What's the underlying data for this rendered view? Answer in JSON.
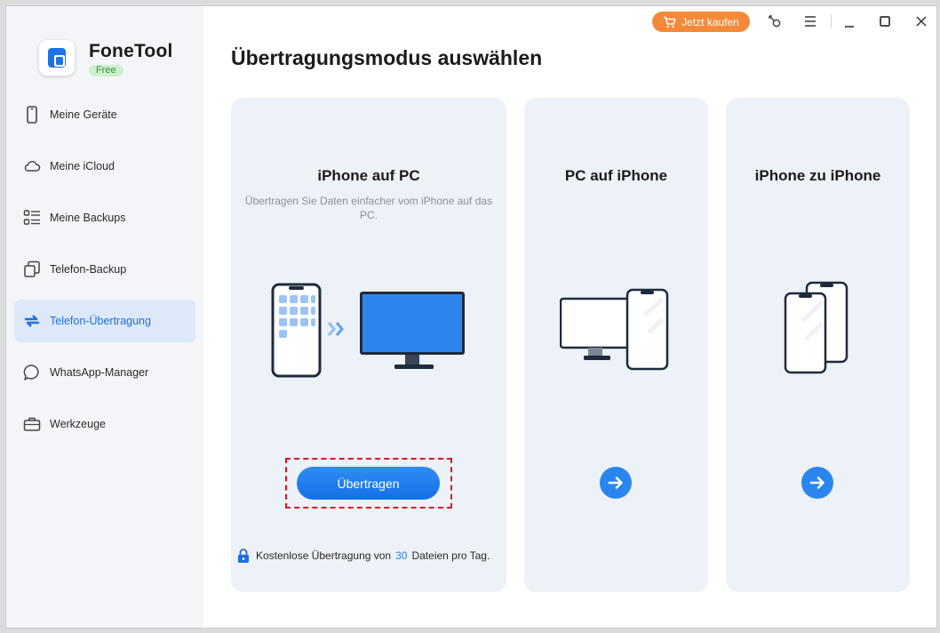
{
  "app": {
    "name": "FoneTool",
    "badge": "Free"
  },
  "sidebar": {
    "items": [
      {
        "label": "Meine Geräte",
        "icon": "phone-icon",
        "active": false
      },
      {
        "label": "Meine iCloud",
        "icon": "cloud-icon",
        "active": false
      },
      {
        "label": "Meine Backups",
        "icon": "list-icon",
        "active": false
      },
      {
        "label": "Telefon-Backup",
        "icon": "copy-icon",
        "active": false
      },
      {
        "label": "Telefon-Übertragung",
        "icon": "transfer-arrows-icon",
        "active": true
      },
      {
        "label": "WhatsApp-Manager",
        "icon": "chat-bubble-icon",
        "active": false
      },
      {
        "label": "Werkzeuge",
        "icon": "toolbox-icon",
        "active": false
      }
    ]
  },
  "titlebar": {
    "buy_label": "Jetzt kaufen"
  },
  "main": {
    "title": "Übertragungsmodus auswählen",
    "cards": [
      {
        "title": "iPhone auf PC",
        "description": "Übertragen Sie Daten einfacher vom iPhone auf das PC.",
        "button_label": "Übertragen",
        "footnote_before": "Kostenlose Übertragung von",
        "footnote_count": "30",
        "footnote_after": "Dateien pro Tag."
      },
      {
        "title": "PC auf iPhone"
      },
      {
        "title": "iPhone zu iPhone"
      }
    ]
  },
  "colors": {
    "accent": "#1f7be8",
    "buy": "#f5893a",
    "highlight": "#e5101e",
    "card_bg": "#edf1f8",
    "sidebar_bg": "#f3f5f9"
  }
}
